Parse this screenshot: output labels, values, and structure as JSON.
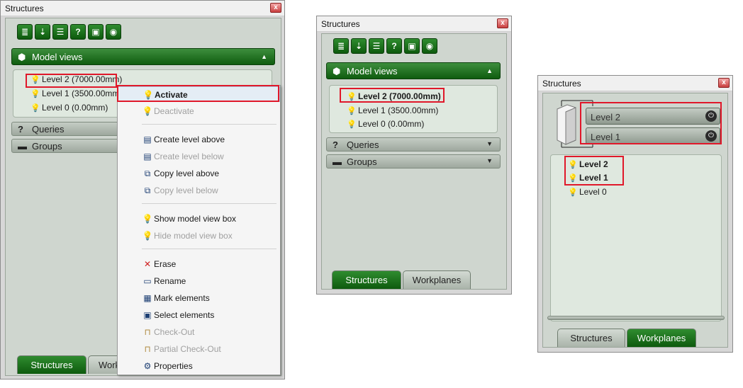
{
  "icons": {
    "toolbar": [
      "stack-icon",
      "import-icon",
      "list-icon",
      "help-icon",
      "folder-icon",
      "eye-icon"
    ],
    "toolbar_glyphs": [
      "≣",
      "⇣",
      "☰",
      "?",
      "▣",
      "◉"
    ]
  },
  "window1": {
    "title": "Structures",
    "close": "x",
    "model_views": "Model views",
    "levels": [
      {
        "label": "Level 2 (7000.00mm)",
        "active": true
      },
      {
        "label": "Level 1 (3500.00mm",
        "active": true
      },
      {
        "label": "Level 0 (0.00mm)",
        "active": true
      }
    ],
    "queries": "Queries",
    "groups": "Groups",
    "tabs": [
      "Structures",
      "Work"
    ],
    "menu": {
      "items": [
        {
          "label": "Activate",
          "icon": "bulb-on-icon",
          "glyph": "💡",
          "disabled": false,
          "bold": true
        },
        {
          "label": "Deactivate",
          "icon": "bulb-off-icon",
          "glyph": "💡",
          "disabled": true
        },
        {
          "label": "Create level above",
          "icon": "create-level-above-icon",
          "glyph": "▤",
          "disabled": false
        },
        {
          "label": "Create level below",
          "icon": "create-level-below-icon",
          "glyph": "▤",
          "disabled": true
        },
        {
          "label": "Copy level above",
          "icon": "copy-level-above-icon",
          "glyph": "⧉",
          "disabled": false
        },
        {
          "label": "Copy level below",
          "icon": "copy-level-below-icon",
          "glyph": "⧉",
          "disabled": true
        },
        {
          "label": "Show model view box",
          "icon": "bulb-on-icon",
          "glyph": "💡",
          "disabled": false
        },
        {
          "label": "Hide model view box",
          "icon": "bulb-off-icon",
          "glyph": "💡",
          "disabled": true
        },
        {
          "label": "Erase",
          "icon": "erase-icon",
          "glyph": "✕",
          "disabled": false
        },
        {
          "label": "Rename",
          "icon": "rename-icon",
          "glyph": "▭",
          "disabled": false
        },
        {
          "label": "Mark elements",
          "icon": "mark-elements-icon",
          "glyph": "▦",
          "disabled": false
        },
        {
          "label": "Select elements",
          "icon": "select-elements-icon",
          "glyph": "▣",
          "disabled": false
        },
        {
          "label": "Check-Out",
          "icon": "check-out-icon",
          "glyph": "⊓",
          "disabled": true
        },
        {
          "label": "Partial Check-Out",
          "icon": "partial-check-out-icon",
          "glyph": "⊓",
          "disabled": true
        },
        {
          "label": "Properties",
          "icon": "properties-icon",
          "glyph": "⚙",
          "disabled": false
        }
      ]
    }
  },
  "window2": {
    "title": "Structures",
    "close": "x",
    "model_views": "Model views",
    "levels": [
      {
        "label": "Level 2 (7000.00mm)",
        "active": true,
        "bold": true
      },
      {
        "label": "Level 1 (3500.00mm)",
        "active": false
      },
      {
        "label": "Level 0 (0.00mm)",
        "active": false
      }
    ],
    "queries": "Queries",
    "groups": "Groups",
    "tabs": [
      "Structures",
      "Workplanes"
    ]
  },
  "window3": {
    "title": "Structures",
    "close": "x",
    "level_buttons": [
      "Level 2",
      "Level 1"
    ],
    "levels": [
      {
        "label": "Level 2",
        "bold": true
      },
      {
        "label": "Level 1",
        "bold": true
      },
      {
        "label": "Level 0",
        "bold": false
      }
    ],
    "tabs": [
      "Structures",
      "Workplanes"
    ]
  },
  "colors": {
    "accent_green": "#0f5c0f",
    "highlight_red": "#e0182a",
    "bulb_on": "#f0c419",
    "bulb_off": "#b5b5b5"
  }
}
